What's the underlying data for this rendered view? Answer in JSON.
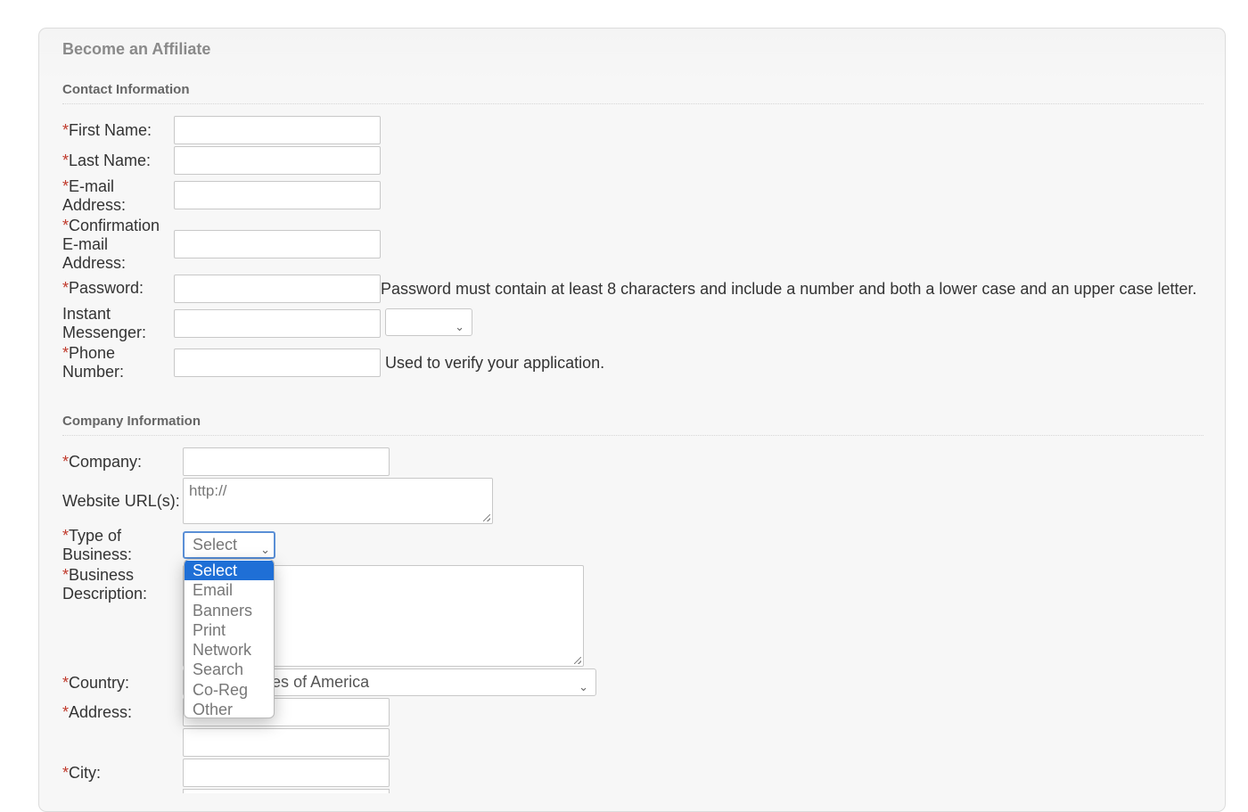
{
  "form_title": "Become an Affiliate",
  "required_marker": "*",
  "contact": {
    "section_title": "Contact Information",
    "first_name_label": "First Name:",
    "last_name_label": "Last Name:",
    "email_label_1": "E-mail",
    "email_label_2": "Address:",
    "confirm_label_1": "Confirmation",
    "confirm_label_2": "E-mail",
    "confirm_label_3": "Address:",
    "password_label": "Password:",
    "password_help": "Password must contain at least 8 characters and include a number and both a lower case and an upper case letter.",
    "im_label_1": "Instant",
    "im_label_2": "Messenger:",
    "phone_label_1": "Phone",
    "phone_label_2": "Number:",
    "phone_help": "Used to verify your application."
  },
  "company": {
    "section_title": "Company Information",
    "company_label": "Company:",
    "website_label": "Website URL(s):",
    "website_value": "http://",
    "type_label_1": "Type of",
    "type_label_2": "Business:",
    "type_selected": "Select",
    "type_options": [
      "Select",
      "Email",
      "Banners",
      "Print",
      "Network",
      "Search",
      "Co-Reg",
      "Other"
    ],
    "description_label_1": "Business",
    "description_label_2": "Description:",
    "country_label": "Country:",
    "country_value": "United States of America",
    "address_label": "Address:",
    "city_label": "City:"
  },
  "colors": {
    "required": "#c0392b",
    "selected_option": "#1f6fd6"
  }
}
